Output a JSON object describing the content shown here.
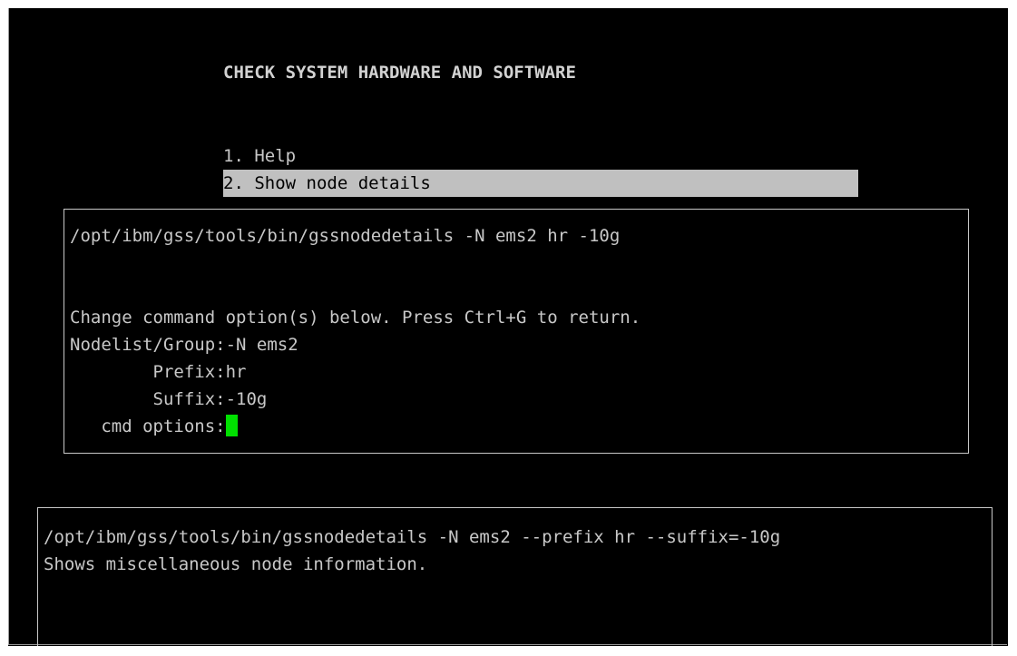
{
  "screen": {
    "title": "CHECK SYSTEM HARDWARE AND SOFTWARE",
    "menu": [
      {
        "label": "1. Help",
        "selected": false
      },
      {
        "label": "2. Show node details",
        "selected": true
      }
    ]
  },
  "command_dialog": {
    "command": "/opt/ibm/gss/tools/bin/gssnodedetails -N ems2 hr -10g",
    "instruction": "Change command option(s) below. Press Ctrl+G to return.",
    "fields": [
      {
        "label": "Nodelist/Group:",
        "value": "-N ems2"
      },
      {
        "label": "        Prefix:",
        "value": "hr"
      },
      {
        "label": "        Suffix:",
        "value": "-10g"
      },
      {
        "label": "   cmd options:",
        "value": ""
      }
    ],
    "cursor_color": "#00e000"
  },
  "description_panel": {
    "full_command": "/opt/ibm/gss/tools/bin/gssnodedetails -N ems2 --prefix hr --suffix=-10g",
    "description": "Shows miscellaneous node information."
  }
}
